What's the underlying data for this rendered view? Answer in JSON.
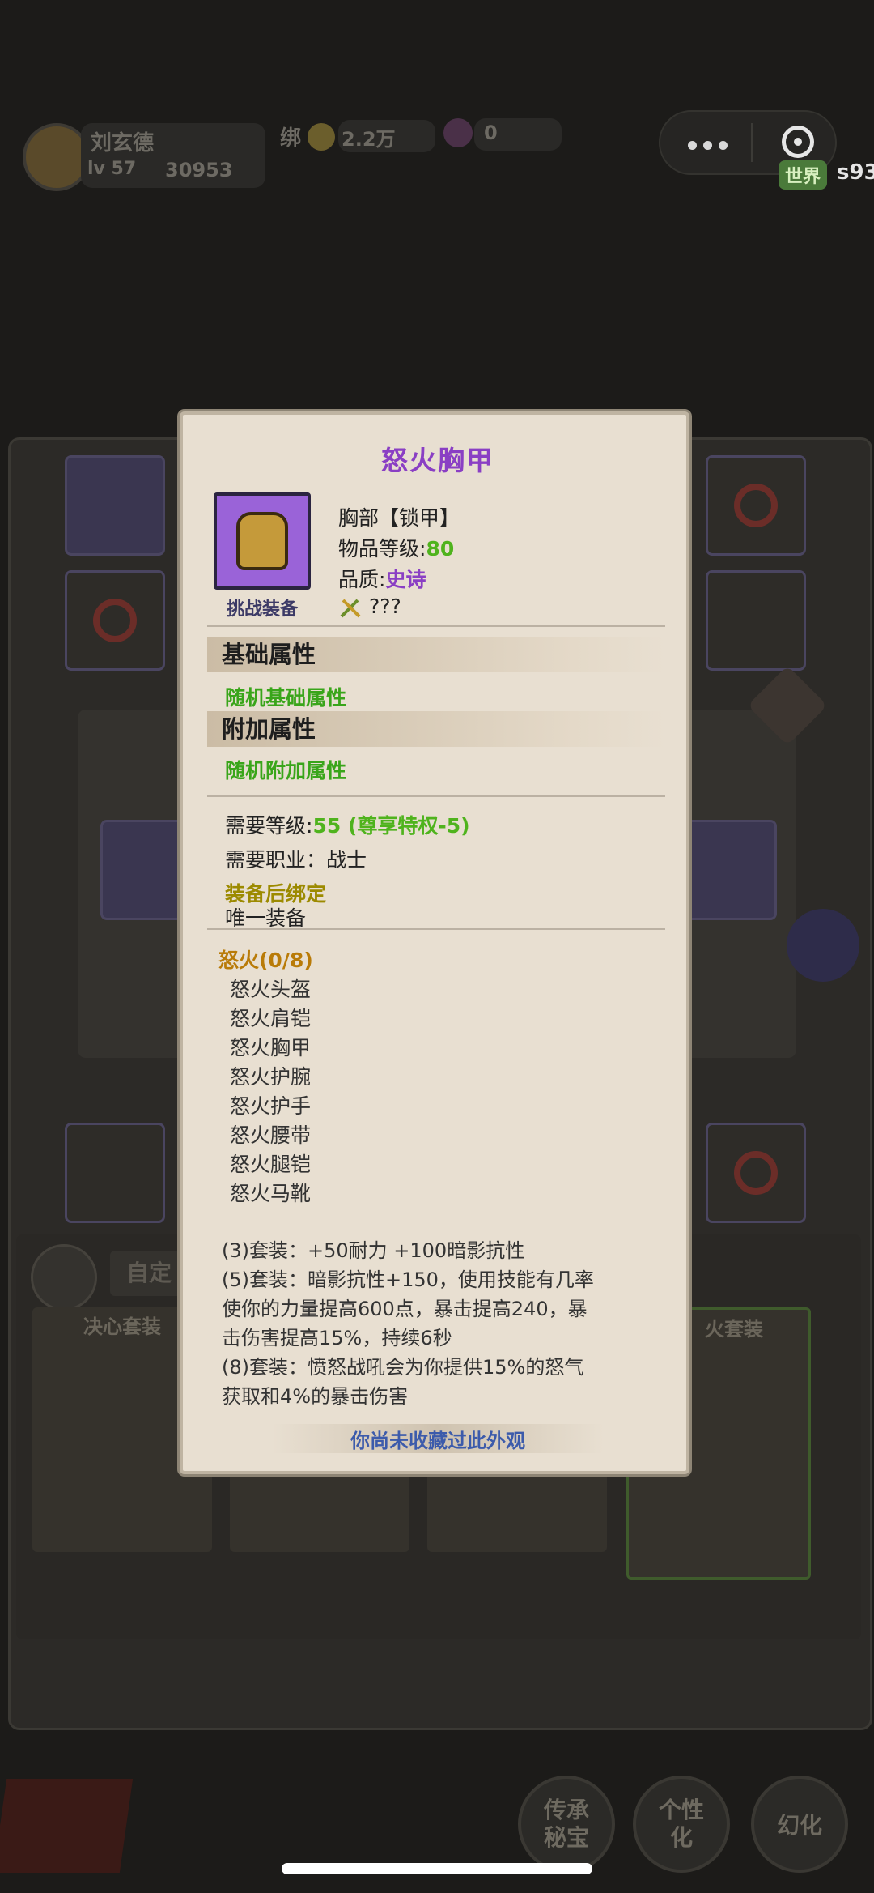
{
  "hud": {
    "player_name": "刘玄德",
    "player_level": "lv 57",
    "power": "30953",
    "bound_label": "绑",
    "gold": "2.2万",
    "gems": "0",
    "world_label": "世界",
    "server": "s93"
  },
  "background": {
    "left_tab": "决心套装",
    "right_tab": "火套装",
    "custom_label": "自定",
    "btn_inherit": "传承\n秘宝",
    "btn_personal": "个性\n化",
    "btn_illusion": "幻化"
  },
  "card": {
    "title": "怒火胸甲",
    "slot_type": "胸部【锁甲】",
    "item_level_label": "物品等级:",
    "item_level_value": "80",
    "quality_label": "品质:",
    "quality_value": "史诗",
    "unknown": "???",
    "challenge_tag": "挑战装备",
    "section_base": "基础属性",
    "base_random": "随机基础属性",
    "section_extra": "附加属性",
    "extra_random": "随机附加属性",
    "req_level_label": "需要等级:",
    "req_level_value": "55 (尊享特权-5)",
    "req_class": "需要职业：战士",
    "bind_on_equip": "装备后绑定",
    "unique_equip": "唯一装备",
    "set_title": "怒火(0/8)",
    "set_items": [
      "怒火头盔",
      "怒火肩铠",
      "怒火胸甲",
      "怒火护腕",
      "怒火护手",
      "怒火腰带",
      "怒火腿铠",
      "怒火马靴"
    ],
    "bonus_3": "(3)套装：+50耐力 +100暗影抗性",
    "bonus_5_line1": "(5)套装：暗影抗性+150，使用技能有几率",
    "bonus_5_line2": "使你的力量提高600点，暴击提高240，暴",
    "bonus_5_line3": "击伤害提高15%，持续6秒",
    "bonus_8_line1": "(8)套装：愤怒战吼会为你提供15%的怒气",
    "bonus_8_line2": "获取和4%的暴击伤害",
    "footer": "你尚未收藏过此外观"
  },
  "colors": {
    "title_purple": "#8a3fc4",
    "green": "#39a51a",
    "footer_blue": "#3c5bab",
    "card_bg": "#e8dfd1"
  }
}
